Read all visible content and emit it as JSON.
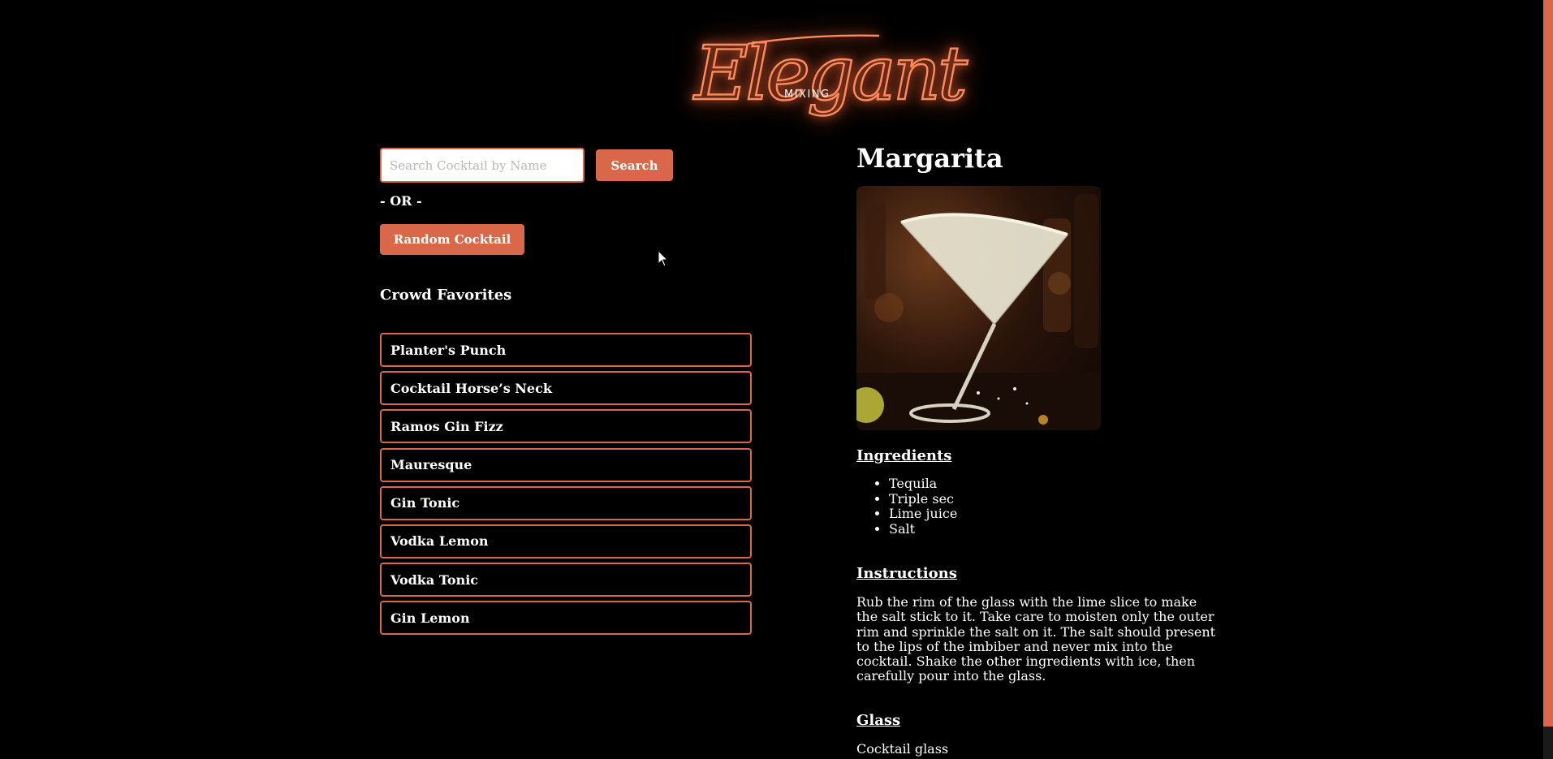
{
  "brand": {
    "logo_script": "Elegant",
    "logo_sub": "MIXING",
    "accent_color": "#d9684a",
    "glow_color": "#ff8a5e"
  },
  "search": {
    "placeholder": "Search Cocktail by Name",
    "value": "",
    "button_label": "Search"
  },
  "or_label": "- OR -",
  "random_button_label": "Random Cocktail",
  "favorites": {
    "title": "Crowd Favorites",
    "items": [
      "Planter's Punch",
      "Cocktail Horse’s Neck",
      "Ramos Gin Fizz",
      "Mauresque",
      "Gin Tonic",
      "Vodka Lemon",
      "Vodka Tonic",
      "Gin Lemon"
    ]
  },
  "cocktail": {
    "name": "Margarita",
    "image_alt": "margarita-cocktail-photo",
    "ingredients_heading": "Ingredients",
    "ingredients": [
      "Tequila",
      "Triple sec",
      "Lime juice",
      "Salt"
    ],
    "instructions_heading": "Instructions",
    "instructions": "Rub the rim of the glass with the lime slice to make the salt stick to it. Take care to moisten only the outer rim and sprinkle the salt on it. The salt should present to the lips of the imbiber and never mix into the cocktail. Shake the other ingredients with ice, then carefully pour into the glass.",
    "glass_heading": "Glass",
    "glass": "Cocktail glass"
  },
  "icons": {
    "cursor": "mouse-pointer-icon"
  }
}
